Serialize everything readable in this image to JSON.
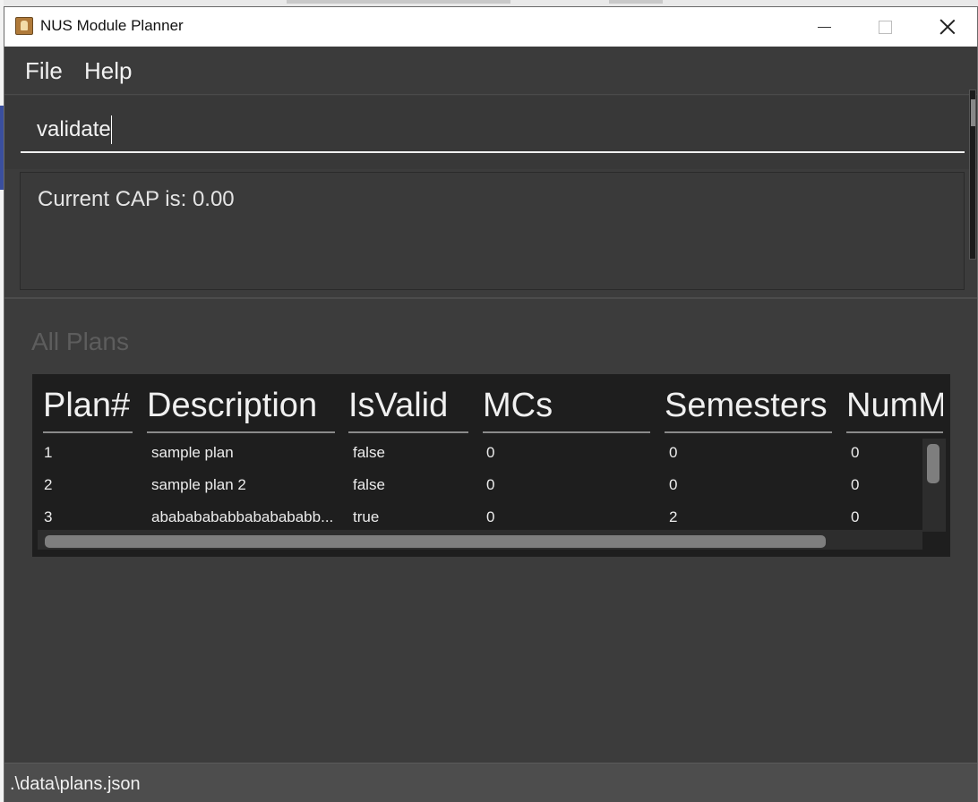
{
  "window": {
    "title": "NUS Module Planner"
  },
  "menu": {
    "file": "File",
    "help": "Help"
  },
  "command": {
    "value": "validate"
  },
  "result": {
    "text": "Current CAP is: 0.00"
  },
  "plans": {
    "title": "All Plans",
    "columns": [
      "Plan#",
      "Description",
      "IsValid",
      "MCs",
      "Semesters",
      "NumM"
    ],
    "rows": [
      [
        "1",
        "sample plan",
        "false",
        "0",
        "0",
        "0"
      ],
      [
        "2",
        "sample plan 2",
        "false",
        "0",
        "0",
        "0"
      ],
      [
        "3",
        "abababababbababababb...",
        "true",
        "0",
        "2",
        "0"
      ]
    ]
  },
  "status": {
    "path": ".\\data\\plans.json"
  },
  "icons": {
    "app": "app-icon",
    "minimize": "minimize-icon",
    "maximize": "maximize-icon",
    "close": "close-icon"
  }
}
